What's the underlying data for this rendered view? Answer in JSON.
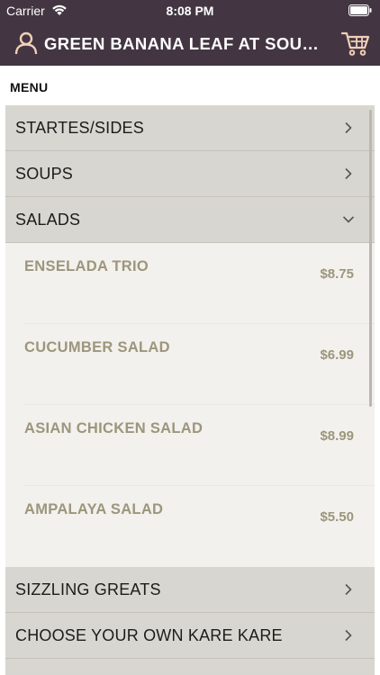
{
  "status_bar": {
    "carrier": "Carrier",
    "time": "8:08 PM"
  },
  "nav": {
    "title": "GREEN BANANA LEAF AT SOUTH…",
    "user_icon": "user-icon",
    "cart_icon": "cart-icon"
  },
  "menu": {
    "label": "MENU",
    "categories": [
      {
        "label": "STARTES/SIDES",
        "icon": "chevron-right-icon"
      },
      {
        "label": "SOUPS",
        "icon": "chevron-right-icon"
      },
      {
        "label": "SALADS",
        "icon": "chevron-down-icon",
        "expanded": true
      }
    ],
    "salad_items": [
      {
        "name": "ENSELADA TRIO",
        "price": "$8.75"
      },
      {
        "name": "CUCUMBER SALAD",
        "price": "$6.99"
      },
      {
        "name": "ASIAN CHICKEN SALAD",
        "price": "$8.99"
      },
      {
        "name": "AMPALAYA SALAD",
        "price": "$5.50"
      }
    ],
    "categories_after": [
      {
        "label": "SIZZLING GREATS",
        "icon": "chevron-right-icon"
      },
      {
        "label": "CHOOSE YOUR OWN KARE KARE",
        "icon": "chevron-right-icon"
      }
    ]
  },
  "colors": {
    "header_bg": "#433642",
    "category_bg": "#d8d6d0",
    "item_bg": "#f2f1ed",
    "item_text": "#9d957c",
    "accent_icon": "#f1cfb8"
  }
}
